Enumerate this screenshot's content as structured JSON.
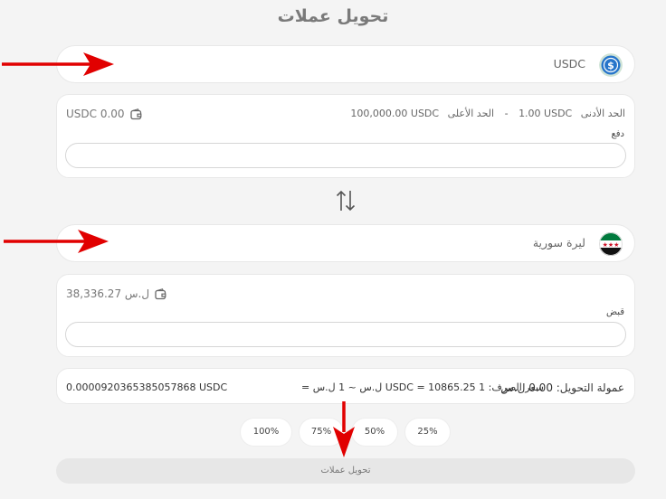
{
  "page": {
    "title": "تحويل عملات"
  },
  "from": {
    "currency_name": "USDC",
    "coin_icon": "usdc-icon",
    "limits": {
      "min_label": "الحد الأدنى",
      "min_value": "1.00 USDC",
      "separator": "-",
      "max_label": "الحد الأعلى",
      "max_value": "100,000.00 USDC"
    },
    "balance": "USDC 0.00",
    "field_label": "دفع",
    "input_value": ""
  },
  "to": {
    "currency_name": "ليرة سورية",
    "coin_icon": "syria-flag-icon",
    "balance": "38,336.27 ل.س",
    "field_label": "قبض",
    "input_value": ""
  },
  "info": {
    "commission": "عمولة التحويل: 0.00 ل.س",
    "rate": "سعر الصرف: 1 USDC = 10865.25 ل.س ~ 1 ل.س =",
    "rate_inverse": "0.0000920365385057868 USDC"
  },
  "percent_buttons": [
    "100%",
    "75%",
    "50%",
    "25%"
  ],
  "convert_button": "تحويل عملات",
  "colors": {
    "annotation_arrow": "#e10000",
    "usdc_blue": "#2775ca",
    "flag_green": "#007a3d"
  }
}
